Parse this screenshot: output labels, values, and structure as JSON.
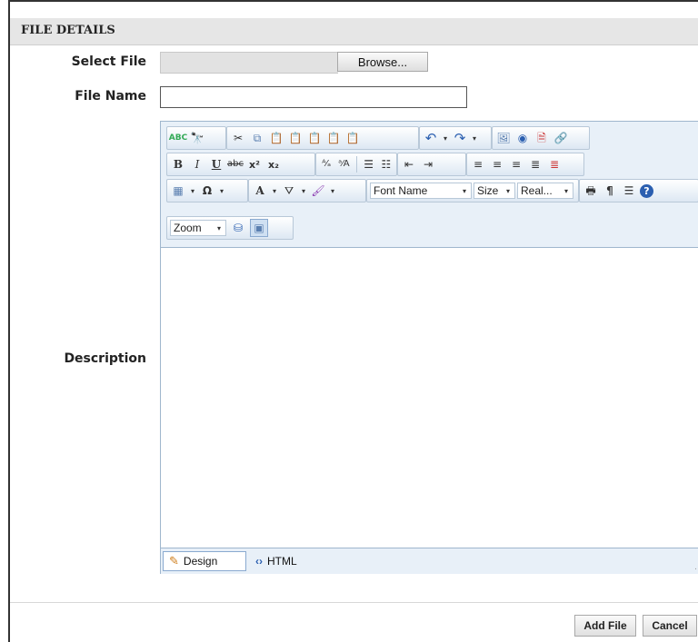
{
  "panel": {
    "title": "FILE DETAILS"
  },
  "form": {
    "select_file_label": "Select File",
    "browse_label": "Browse...",
    "file_name_label": "File Name",
    "file_name_value": "",
    "description_label": "Description"
  },
  "editor": {
    "font_name": "Font Name",
    "size": "Size",
    "paragraph": "Real...",
    "zoom": "Zoom",
    "design_tab": "Design",
    "html_tab": "HTML"
  },
  "actions": {
    "add_file": "Add File",
    "cancel": "Cancel"
  },
  "colors": {
    "header_bg": "#e6e6e6",
    "toolbar_bg": "#e8f0f8",
    "editor_border": "#9fb6cd"
  }
}
